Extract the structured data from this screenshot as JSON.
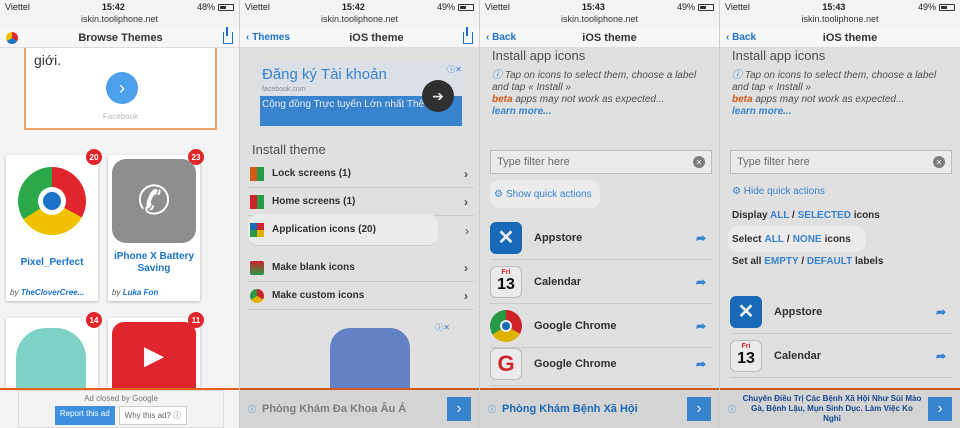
{
  "panels": [
    {
      "status": {
        "carrier": "Viettel",
        "time": "15:42",
        "battery": "48%"
      },
      "url": "iskin.tooliphone.net",
      "nav": {
        "title": "Browse Themes"
      },
      "ad_card": {
        "text": "giới.",
        "source": "Facebook"
      },
      "themes": [
        {
          "badge": "20",
          "name": "Pixel_Perfect",
          "by_prefix": "by",
          "author": "TheCloverCree..."
        },
        {
          "badge": "23",
          "name": "iPhone X Battery Saving",
          "by_prefix": "by",
          "author": "Luka Fon"
        },
        {
          "badge": "14"
        },
        {
          "badge": "11"
        }
      ],
      "ad_closed": {
        "text": "Ad closed by Google",
        "report": "Report this ad",
        "why": "Why this ad? ⓘ"
      }
    },
    {
      "status": {
        "carrier": "Viettel",
        "time": "15:42",
        "battery": "49%"
      },
      "url": "iskin.tooliphone.net",
      "nav": {
        "back": "Themes",
        "title": "iOS theme"
      },
      "banner": {
        "title": "Đăng ký Tài khoản",
        "sub": "facebook.com",
        "line": "Cộng đồng Trực tuyến Lớn nhất Thế giới"
      },
      "heading": "Install theme",
      "rows": [
        {
          "label": "Lock screens (1)"
        },
        {
          "label": "Home screens (1)"
        },
        {
          "label": "Application icons (20)"
        },
        {
          "label": "Make blank icons"
        },
        {
          "label": "Make custom icons"
        }
      ],
      "bottom_ad": "Phòng Khám Đa Khoa Âu Á"
    },
    {
      "status": {
        "carrier": "Viettel",
        "time": "15:43",
        "battery": "49%"
      },
      "url": "iskin.tooliphone.net",
      "nav": {
        "back": "Back",
        "title": "iOS theme"
      },
      "heading": "Install app icons",
      "tip": "Tap on icons to select them, choose a label and tap « Install »",
      "beta_word": "beta",
      "beta_rest": "apps may not work as expected...",
      "learn": "learn more...",
      "filter": "Type filter here",
      "quick": "Show quick actions",
      "apps": [
        {
          "name": "Appstore"
        },
        {
          "name": "Calendar",
          "day": "13",
          "weekday": "Fri"
        },
        {
          "name": "Google Chrome"
        },
        {
          "name": "Google Chrome"
        }
      ],
      "bottom_ad": "Phòng Khám Bệnh Xã Hội"
    },
    {
      "status": {
        "carrier": "Viettel",
        "time": "15:43",
        "battery": "49%"
      },
      "url": "iskin.tooliphone.net",
      "nav": {
        "back": "Back",
        "title": "iOS theme"
      },
      "heading": "Install app icons",
      "tip": "Tap on icons to select them, choose a label and tap « Install »",
      "beta_word": "beta",
      "beta_rest": "apps may not work as expected...",
      "learn": "learn more...",
      "filter": "Type filter here",
      "quick": "Hide quick actions",
      "display": {
        "prefix": "Display",
        "all": "ALL",
        "sep": "/",
        "selected": "SELECTED",
        "suffix": "icons"
      },
      "select": {
        "prefix": "Select",
        "all": "ALL",
        "sep": "/",
        "none": "NONE",
        "suffix": "icons"
      },
      "setall": {
        "prefix": "Set all",
        "empty": "EMPTY",
        "sep": "/",
        "default": "DEFAULT",
        "suffix": "labels"
      },
      "apps": [
        {
          "name": "Appstore"
        },
        {
          "name": "Calendar",
          "day": "13",
          "weekday": "Fri"
        }
      ],
      "bottom_ad": "Chuyên Điều Trị Các Bệnh Xã Hội Như Sùi Mào Gà, Bệnh Lậu, Mụn Sinh Dục. Làm Việc Ko Nghỉ"
    }
  ]
}
